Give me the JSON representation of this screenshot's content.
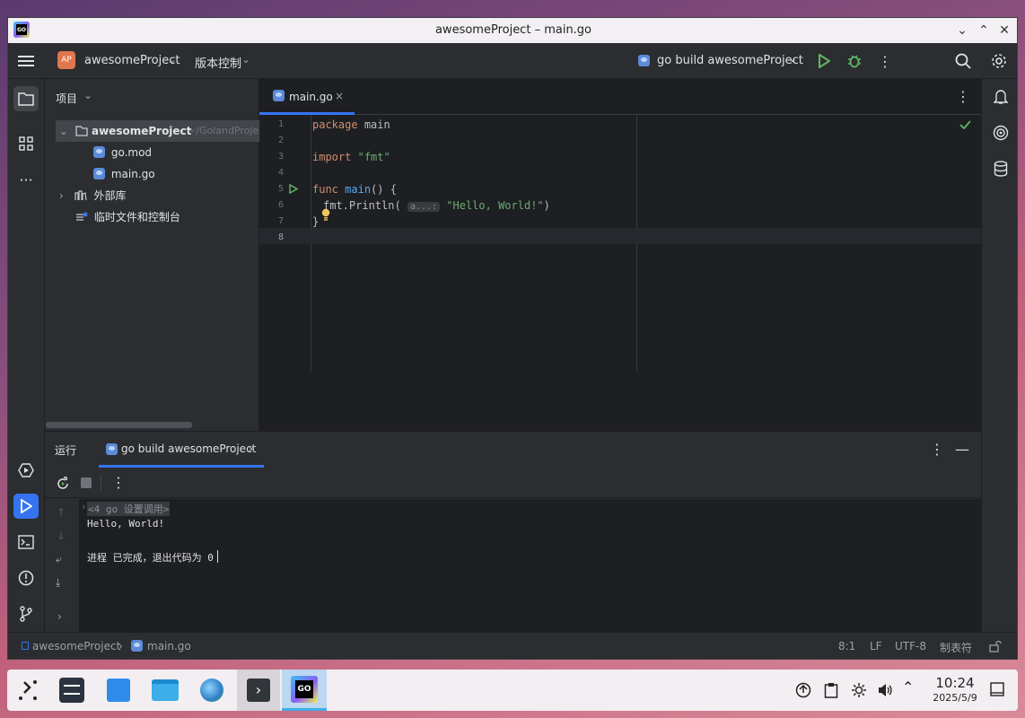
{
  "window": {
    "title": "awesomeProject – main.go"
  },
  "toolbar": {
    "project_badge": "AP",
    "project_name": "awesomeProject",
    "vcs_label": "版本控制",
    "run_config": "go build awesomeProject"
  },
  "project_panel": {
    "title": "项目",
    "tree": {
      "root_name": "awesomeProject",
      "root_path": "~/GolandProjects",
      "files": [
        "go.mod",
        "main.go"
      ],
      "external_libs": "外部库",
      "scratches": "临时文件和控制台"
    }
  },
  "editor": {
    "tab": "main.go",
    "line_numbers": [
      "1",
      "2",
      "3",
      "4",
      "5",
      "6",
      "7",
      "8"
    ],
    "code": {
      "l1_kw": "package",
      "l1_id": "main",
      "l3_kw": "import",
      "l3_str": "\"fmt\"",
      "l5_kw": "func",
      "l5_fn": "main",
      "l5_rest": "() {",
      "l6_a": "fmt.",
      "l6_b": "Println(",
      "l6_hint": "a...:",
      "l6_str": "\"Hello, World!\"",
      "l6_end": ")",
      "l7": "}"
    }
  },
  "run_panel": {
    "title": "运行",
    "tab": "go build awesomeProject",
    "output": {
      "cmd": "<4 go 设置调用>",
      "hello": "Hello, World!",
      "exit": "进程 已完成，退出代码为 0"
    }
  },
  "statusbar": {
    "breadcrumb_project": "awesomeProject",
    "breadcrumb_file": "main.go",
    "position": "8:1",
    "line_sep": "LF",
    "encoding": "UTF-8",
    "indent": "制表符"
  },
  "taskbar": {
    "time": "10:24",
    "date": "2025/5/9"
  },
  "colors": {
    "accent": "#3574f0",
    "keyword": "#cf8e6d",
    "function": "#56a8f5",
    "string": "#6aab73"
  }
}
